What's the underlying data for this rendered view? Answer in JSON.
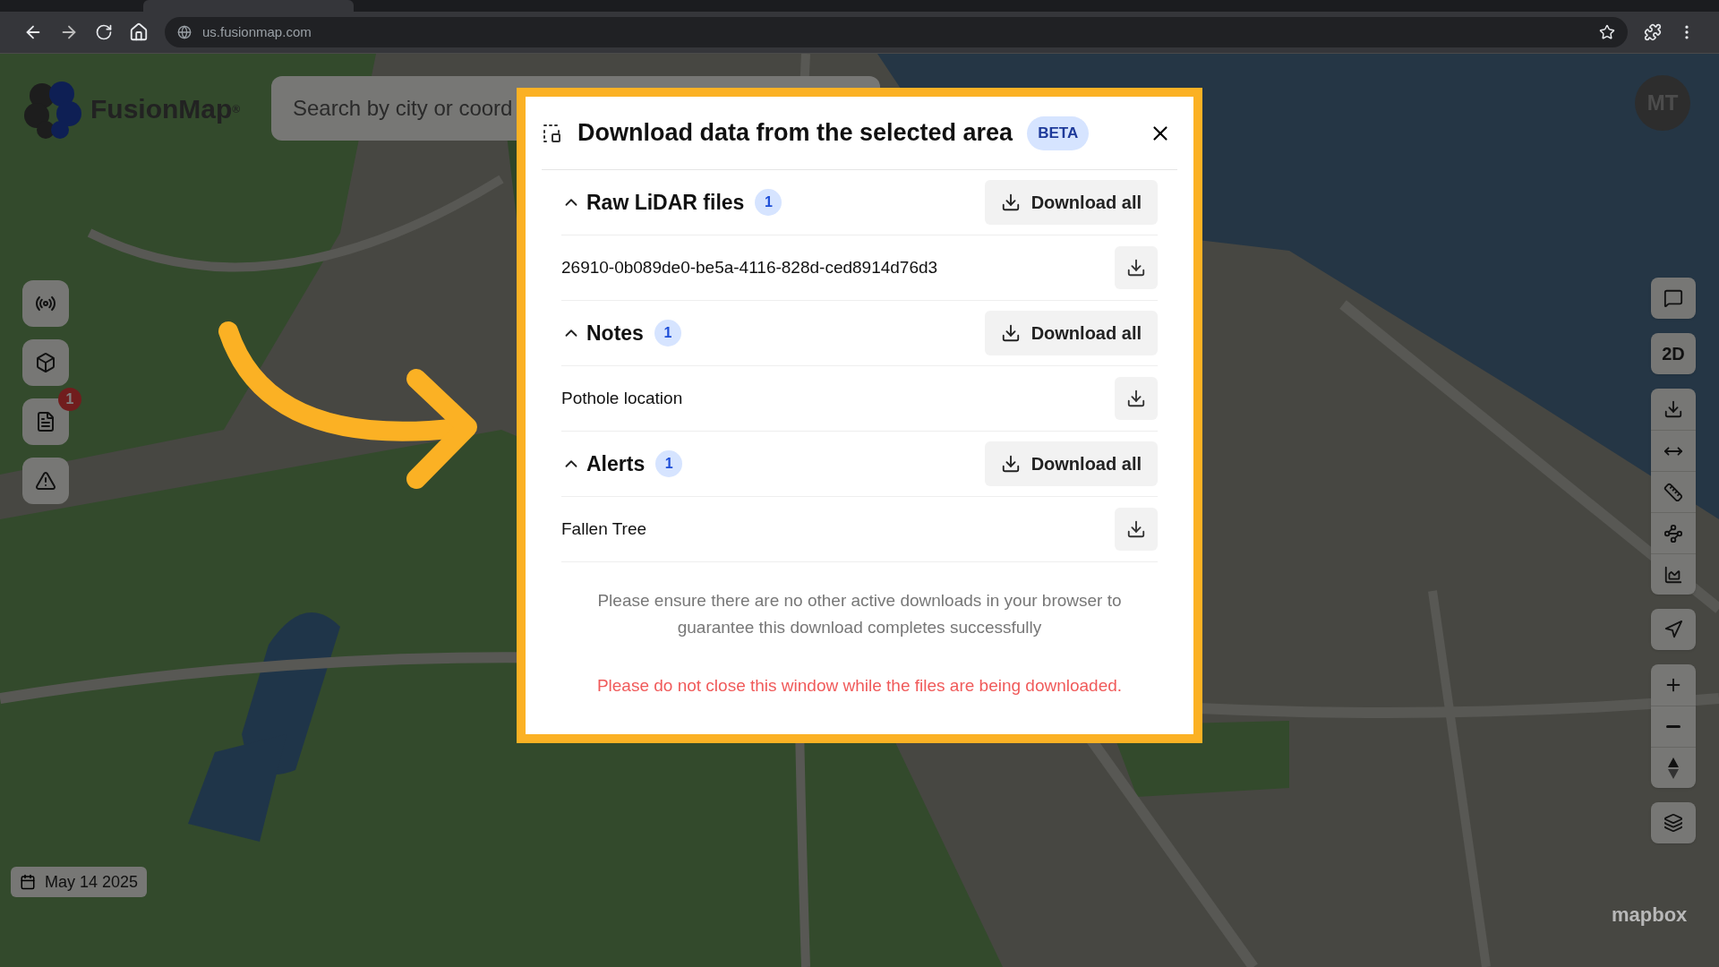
{
  "browser": {
    "url": "us.fusionmap.com"
  },
  "app": {
    "logo": "FusionMap",
    "logo_mark": "®",
    "search": {
      "placeholder": "Search by city or coord"
    },
    "user": {
      "initials": "MT"
    },
    "left_tools": [
      {
        "kind": "antenna"
      },
      {
        "kind": "cube"
      },
      {
        "kind": "notes",
        "badge": "1"
      },
      {
        "kind": "alert"
      }
    ],
    "right_toolbar": [
      {
        "tools": [
          {
            "kind": "chat"
          }
        ]
      },
      {
        "tools": [
          {
            "kind": "label",
            "label": "2D"
          }
        ]
      },
      {
        "tools": [
          {
            "kind": "download"
          },
          {
            "kind": "split"
          },
          {
            "kind": "ruler"
          },
          {
            "kind": "polygon"
          },
          {
            "kind": "chart"
          }
        ]
      },
      {
        "tools": [
          {
            "kind": "locate"
          }
        ]
      },
      {
        "tools": [
          {
            "kind": "zoom-in"
          },
          {
            "kind": "zoom-out"
          },
          {
            "kind": "compass"
          }
        ]
      },
      {
        "tools": [
          {
            "kind": "layers"
          }
        ]
      }
    ],
    "date": "May 14 2025",
    "attribution": "mapbox"
  },
  "dialog": {
    "title": "Download data from the selected area",
    "badge": "BETA",
    "sections": [
      {
        "title": "Raw LiDAR files",
        "count": "1",
        "expanded": true,
        "action": "Download all",
        "items": [
          "26910-0b089de0-be5a-4116-828d-ced8914d76d3"
        ]
      },
      {
        "title": "Notes",
        "count": "1",
        "expanded": true,
        "action": "Download all",
        "items": [
          "Pothole location"
        ]
      },
      {
        "title": "Alerts",
        "count": "1",
        "expanded": true,
        "action": "Download all",
        "items": [
          "Fallen Tree"
        ]
      }
    ],
    "note": "Please ensure there are no other active downloads in your browser to guarantee this download completes successfully",
    "warning": "Please do not close this window while the files are being downloaded."
  }
}
